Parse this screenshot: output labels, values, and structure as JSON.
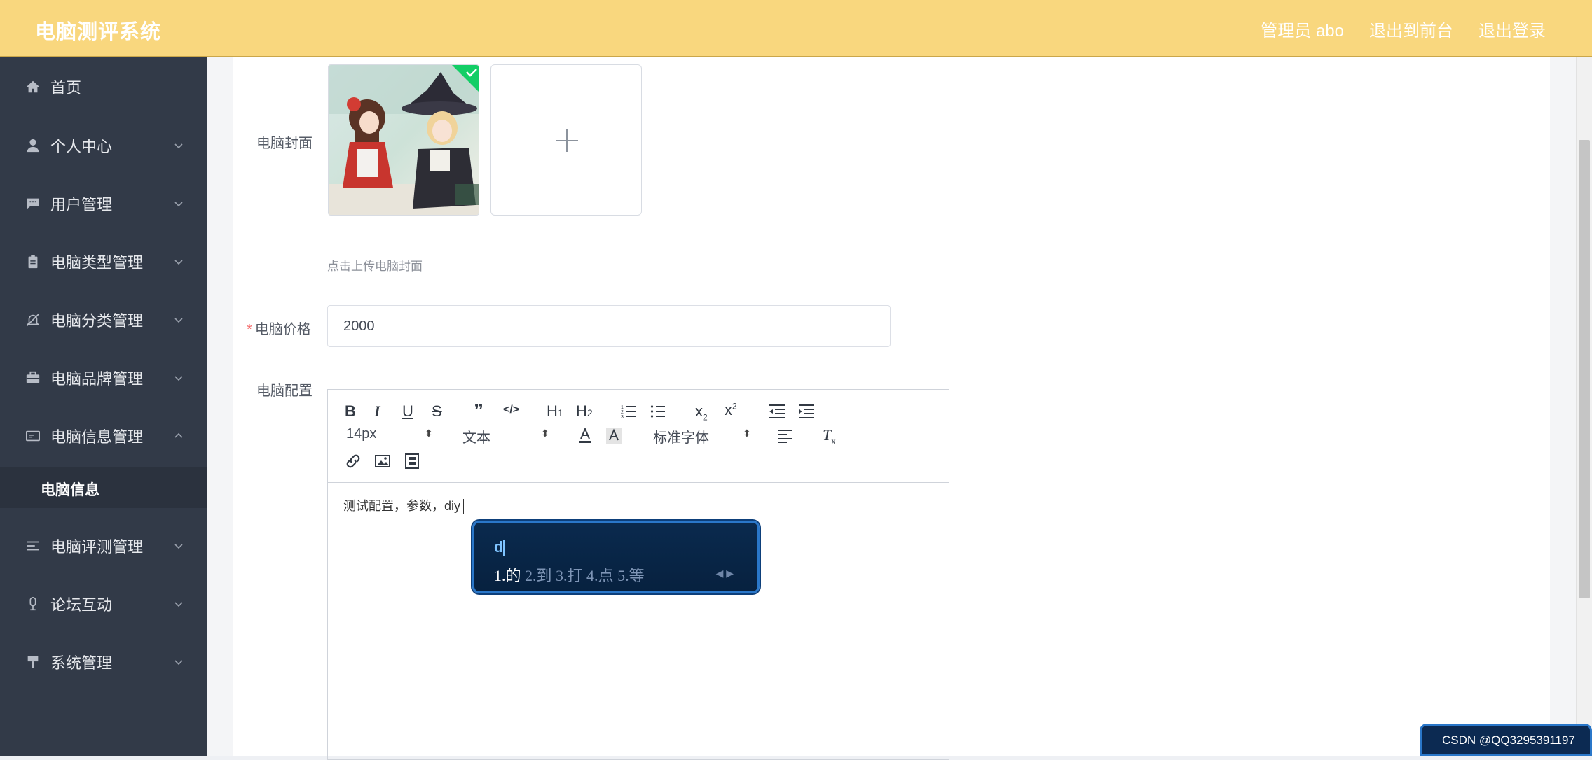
{
  "header": {
    "title": "电脑测评系统",
    "links": [
      "管理员 abo",
      "退出到前台",
      "退出登录"
    ]
  },
  "sidebar": {
    "items": [
      {
        "label": "首页",
        "icon": "home-icon",
        "expandable": false
      },
      {
        "label": "个人中心",
        "icon": "user-icon",
        "expandable": true
      },
      {
        "label": "用户管理",
        "icon": "chat-icon",
        "expandable": true
      },
      {
        "label": "电脑类型管理",
        "icon": "clipboard-icon",
        "expandable": true
      },
      {
        "label": "电脑分类管理",
        "icon": "bell-off-icon",
        "expandable": true
      },
      {
        "label": "电脑品牌管理",
        "icon": "briefcase-icon",
        "expandable": true
      },
      {
        "label": "电脑信息管理",
        "icon": "id-card-icon",
        "expandable": true,
        "expanded": true
      },
      {
        "label": "电脑评测管理",
        "icon": "list-icon",
        "expandable": true
      },
      {
        "label": "论坛互动",
        "icon": "microphone-icon",
        "expandable": true
      },
      {
        "label": "系统管理",
        "icon": "brush-icon",
        "expandable": true
      }
    ],
    "submenu": {
      "label": "电脑信息"
    }
  },
  "form": {
    "cover_label": "电脑封面",
    "upload_tip": "点击上传电脑封面",
    "price_label": "电脑价格",
    "price_required_mark": "*",
    "price_value": "2000",
    "config_label": "电脑配置"
  },
  "editor": {
    "font_size": "14px",
    "text_style": "文本",
    "font_family": "标准字体",
    "content": "测试配置，参数，diy"
  },
  "ime": {
    "composition": "d",
    "candidates": [
      "1.的",
      "2.到",
      "3.打",
      "4.点",
      "5.等"
    ]
  },
  "watermark": "CSDN @QQ3295391197",
  "colors": {
    "header_bg": "#f9d77e",
    "sidebar_bg": "#323a48",
    "required": "#f56c6c",
    "ime_border": "#2a77c9"
  }
}
